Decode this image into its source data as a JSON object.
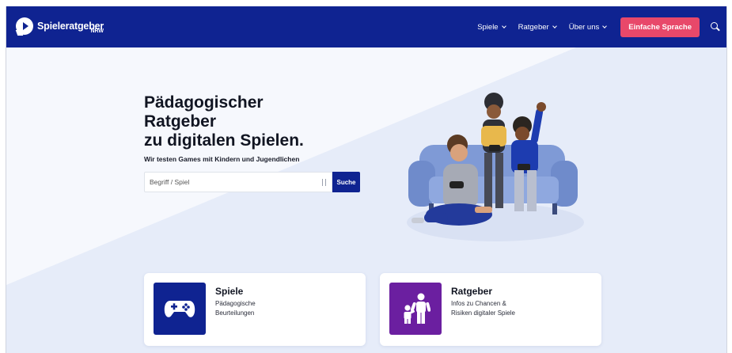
{
  "header": {
    "logo_name": "Spieleratgeber",
    "logo_sub": "NRW",
    "nav": [
      {
        "label": "Spiele"
      },
      {
        "label": "Ratgeber"
      },
      {
        "label": "Über uns"
      }
    ],
    "easy_language_button": "Einfache Sprache"
  },
  "hero": {
    "title_line1": "Pädagogischer",
    "title_line2": "Ratgeber",
    "title_line3": "zu digitalen Spielen.",
    "subtitle": "Wir testen Games mit Kindern und Jugendlichen",
    "search_placeholder": "Begriff / Spiel",
    "search_value": "",
    "search_button": "Suche"
  },
  "cards": [
    {
      "title": "Spiele",
      "desc_line1": "Pädagogische",
      "desc_line2": "Beurteilungen",
      "icon": "gamepad-icon"
    },
    {
      "title": "Ratgeber",
      "desc_line1": "Infos zu Chancen &",
      "desc_line2": "Risiken digitaler Spiele",
      "icon": "parent-child-icon"
    }
  ],
  "colors": {
    "brand_blue": "#0f2391",
    "accent_pink": "#e8486a",
    "ratgeber_purple": "#6b1fa0",
    "hero_bg": "#e9eefa"
  }
}
